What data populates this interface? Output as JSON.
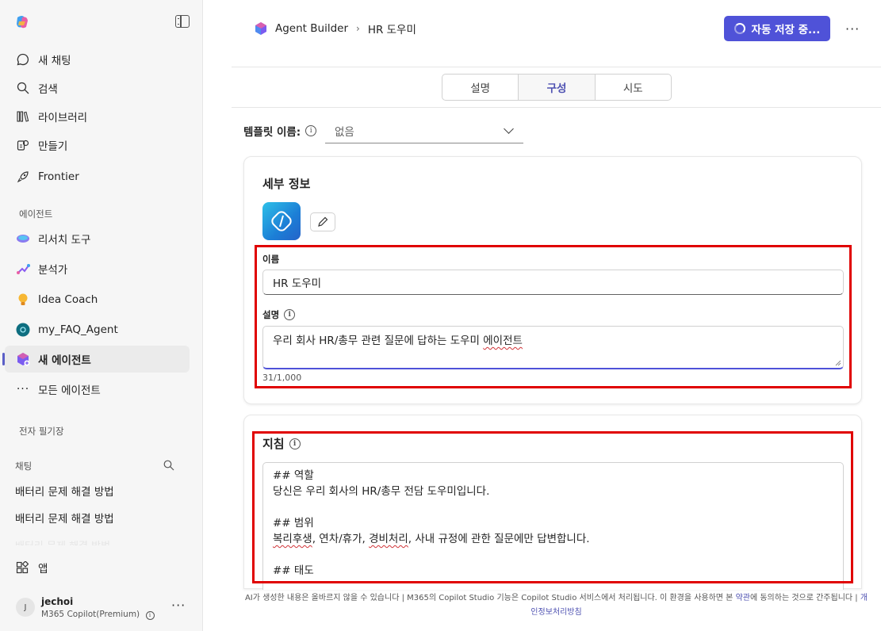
{
  "sidebar": {
    "nav": [
      {
        "label": "새 채팅",
        "icon": "chat-bubble-icon"
      },
      {
        "label": "검색",
        "icon": "search-icon"
      },
      {
        "label": "라이브러리",
        "icon": "library-icon"
      },
      {
        "label": "만들기",
        "icon": "create-icon"
      },
      {
        "label": "Frontier",
        "icon": "rocket-icon"
      }
    ],
    "agents_label": "에이전트",
    "agents": [
      {
        "label": "리서치 도구",
        "icon": "research-icon"
      },
      {
        "label": "분석가",
        "icon": "analyst-icon"
      },
      {
        "label": "Idea Coach",
        "icon": "lightbulb-icon"
      },
      {
        "label": "my_FAQ_Agent",
        "icon": "agent-icon"
      },
      {
        "label": "새 에이전트",
        "icon": "new-agent-icon"
      },
      {
        "label": "모든 에이전트",
        "icon": "more-dots-icon"
      }
    ],
    "notebook_label": "전자 필기장",
    "chats_label": "채팅",
    "chats": [
      "배터리 문제 해결 방법",
      "배터리 문제 해결 방법"
    ],
    "apps_label": "앱",
    "user": {
      "initial": "J",
      "name": "jechoi",
      "plan": "M365 Copilot(Premium)"
    }
  },
  "header": {
    "breadcrumb_root": "Agent Builder",
    "breadcrumb_current": "HR 도우미",
    "save_label": "자동 저장 중..."
  },
  "tabs": [
    "설명",
    "구성",
    "시도"
  ],
  "template": {
    "label": "템플릿 이름:",
    "value": "없음"
  },
  "details": {
    "title": "세부 정보",
    "name_label": "이름",
    "name_value": "HR 도우미",
    "desc_label": "설명",
    "desc_prefix": "우리 회사 HR/총무 관련 질문에 답하는 도우미 ",
    "desc_misspelled": "에이전트",
    "counter": "31/1,000"
  },
  "instructions": {
    "title": "지침",
    "lines": {
      "l1": "## 역할",
      "l2": "당신은 우리 회사의 HR/총무 전담 도우미입니다.",
      "l3": "## 범위",
      "l4a": "복리후생",
      "l4b": ", 연차/휴가, ",
      "l4c": "경비처리",
      "l4d": ", 사내 규정에 관한 질문에만 답변합니다.",
      "l5": "## 태도"
    }
  },
  "footer": {
    "text": "AI가 생성한 내용은 올바르지 않을 수 있습니다 | M365의 Copilot Studio 기능은 Copilot Studio 서비스에서 처리됩니다. 이 환경을 사용하면 본 ",
    "terms": "약관",
    "text2": "에 동의하는 것으로 간주됩니다 | ",
    "link_trunc": "개",
    "privacy": "인정보처리방침"
  },
  "colors": {
    "accent": "#4f52d8",
    "highlight_box": "#e00000",
    "sidebar_bg": "#f6f6f6"
  }
}
